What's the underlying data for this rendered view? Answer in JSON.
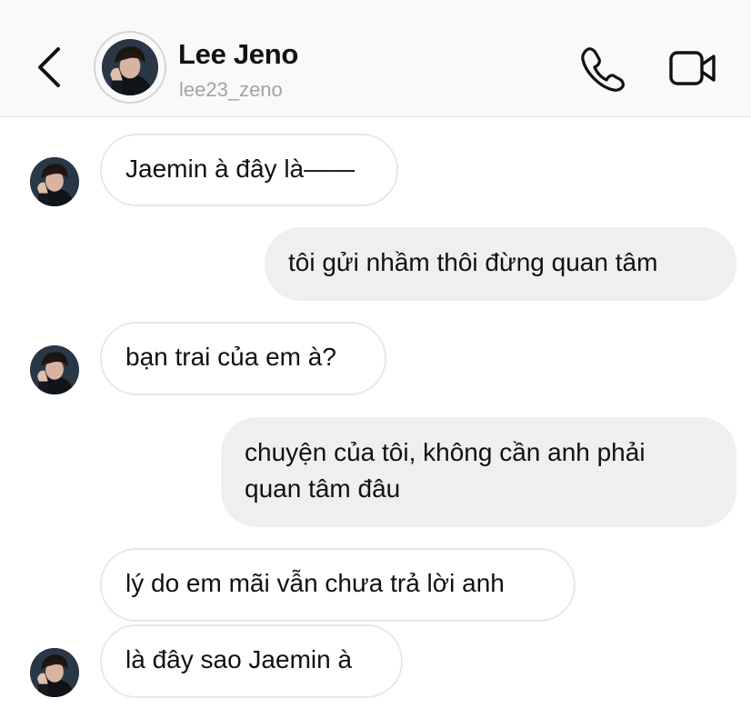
{
  "header": {
    "name": "Lee Jeno",
    "username": "lee23_zeno",
    "icons": {
      "back": "chevron-left-icon",
      "call": "phone-icon",
      "video": "video-camera-icon"
    }
  },
  "messages": [
    {
      "sender": "other",
      "text": "Jaemin à đây là——"
    },
    {
      "sender": "me",
      "text": "tôi gửi nhầm thôi đừng quan tâm"
    },
    {
      "sender": "other",
      "text": "bạn trai của em à?"
    },
    {
      "sender": "me",
      "text": "chuyện của tôi, không cần anh phải\nquan tâm đâu"
    },
    {
      "sender": "other",
      "text": "lý do em mãi vẫn chưa trả lời anh"
    },
    {
      "sender": "other",
      "text": "là đây sao Jaemin à"
    }
  ],
  "colors": {
    "header_bg": "#f9f9f9",
    "incoming_bubble_bg": "#ffffff",
    "incoming_bubble_border": "#e8e8e8",
    "outgoing_bubble_bg": "#efefef",
    "text": "#111111",
    "secondary_text": "#a3a3a3"
  }
}
